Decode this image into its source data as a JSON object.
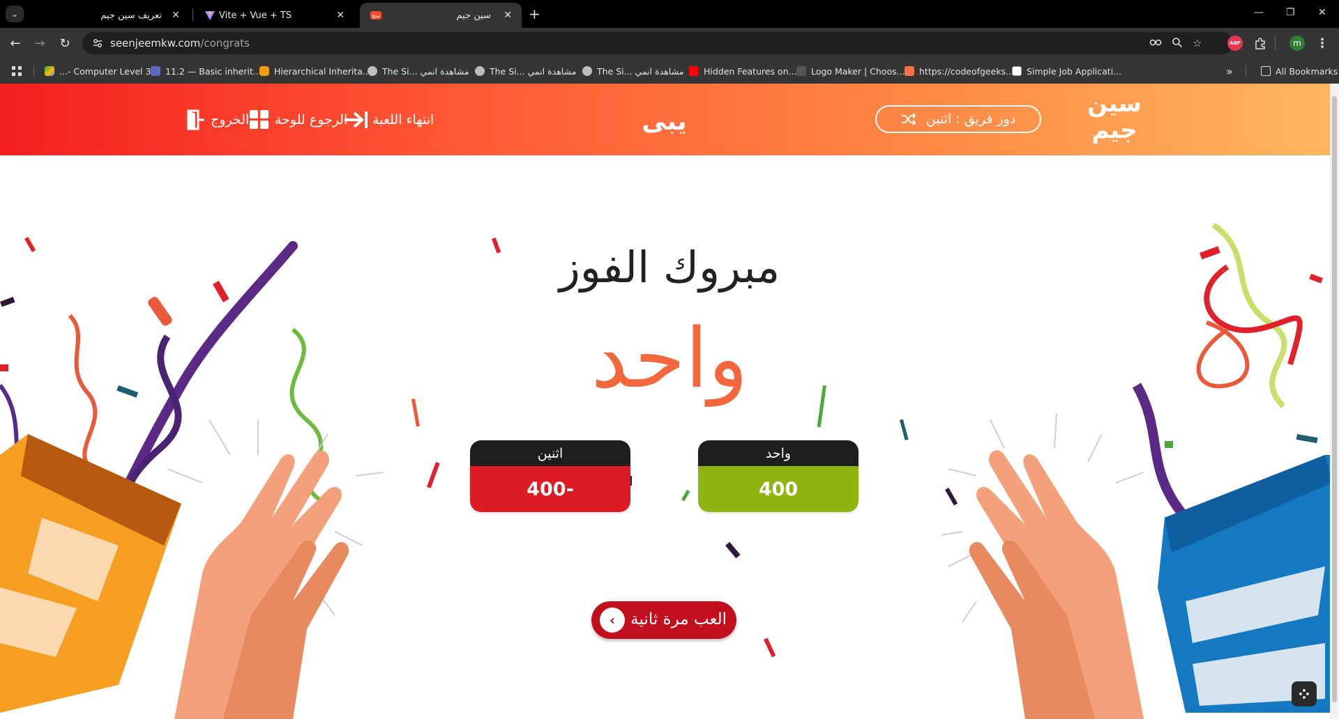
{
  "tabs": [
    {
      "title": "تعريف سين جيم",
      "close": "✕",
      "active": false
    },
    {
      "title": "Vite + Vue + TS",
      "close": "✕",
      "active": false
    },
    {
      "title": "سين جيم",
      "close": "✕",
      "active": true
    }
  ],
  "new_tab": "+",
  "window_controls": {
    "minimize": "—",
    "restore": "❐",
    "close": "✕"
  },
  "toolbar": {
    "back": "←",
    "forward": "→",
    "reload": "↻",
    "url_host": "seenjeemkw.com",
    "url_path": "/congrats",
    "profile_initial": "m",
    "adblock_label": "ABP"
  },
  "bookmarks": [
    {
      "label": "...- Computer Level 3",
      "icon_color": "#34a853"
    },
    {
      "label": "11.2 — Basic inherit...",
      "icon_color": "#5c6bc0"
    },
    {
      "label": "Hierarchical Inherita...",
      "icon_color": "#f59e0b"
    },
    {
      "label": "The Si... مشاهدة انمي",
      "icon_color": "#9e9e9e"
    },
    {
      "label": "The Si... مشاهدة انمي",
      "icon_color": "#9e9e9e"
    },
    {
      "label": "The Si... مشاهدة انمي",
      "icon_color": "#9e9e9e"
    },
    {
      "label": "Hidden Features on...",
      "icon_color": "#ff0000"
    },
    {
      "label": "Logo Maker | Choos...",
      "icon_color": "#444444"
    },
    {
      "label": "https://codeofgeeks...",
      "icon_color": "#ff7043"
    },
    {
      "label": "Simple Job Applicati...",
      "icon_color": "#ffffff"
    }
  ],
  "bookmarks_more": "»",
  "all_bookmarks": "All Bookmarks",
  "header": {
    "exit": "الخروج",
    "back_to_board": "الرجوع للوحة",
    "end_game": "انتهاء اللعبة",
    "center_logo": "يبى",
    "turn_label": "دور فريق : اثنين",
    "brand_line1": "سين",
    "brand_line2": "جيم"
  },
  "congrats_title": "مبروك الفوز",
  "winner_name": "واحد",
  "teams": [
    {
      "name": "اثنين",
      "score": "400-",
      "color": "#dd1b24"
    },
    {
      "name": "واحد",
      "score": "400",
      "color": "#8fb40f"
    }
  ],
  "play_again": {
    "label": "العب مرة ثانية",
    "icon": "‹"
  },
  "colors": {
    "accent_red": "#f41f1f",
    "accent_orange": "#ffb760",
    "winner": "#f4663c",
    "play_again": "#c20f1e"
  }
}
